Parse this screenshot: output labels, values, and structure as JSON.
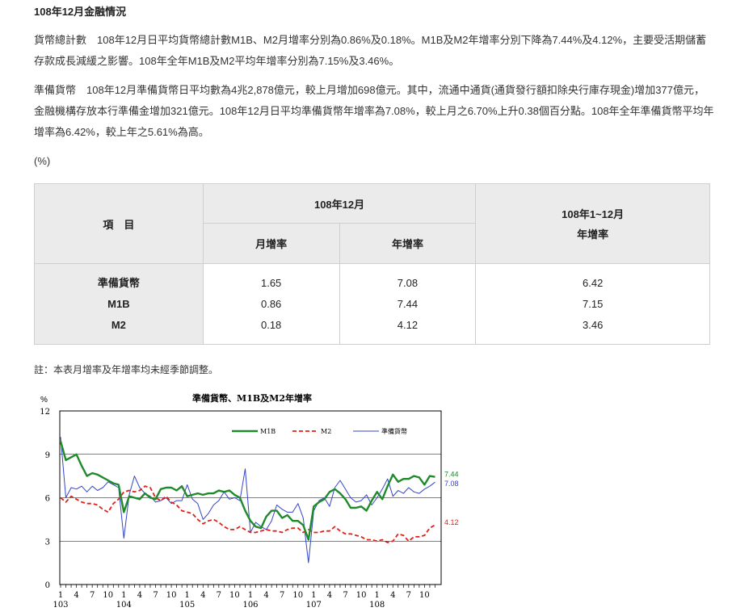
{
  "title": "108年12月金融情況",
  "paragraphs": {
    "p1": "貨幣總計數　108年12月日平均貨幣總計數M1B、M2月增率分別為0.86%及0.18%。M1B及M2年增率分別下降為7.44%及4.12%，主要受活期儲蓄存款成長減緩之影響。108年全年M1B及M2平均年增率分別為7.15%及3.46%。",
    "p2": "準備貨幣　108年12月準備貨幣日平均數為4兆2,878億元，較上月增加698億元。其中，流通中通貨(通貨發行額扣除央行庫存現金)增加377億元，金融機構存放本行準備金增加321億元。108年12月日平均準備貨幣年增率為7.08%，較上月之6.70%上升0.38個百分點。108年全年準備貨幣平均年增率為6.42%，較上年之5.61%為高。"
  },
  "unit": "(%)",
  "table": {
    "item_header": "項　目",
    "month_header": "108年12月",
    "col_mom": "月增率",
    "col_yoy": "年增率",
    "year_header_line1": "108年1~12月",
    "year_header_line2": "年增率",
    "row_names": [
      "準備貨幣",
      "M1B",
      "M2"
    ],
    "mom": [
      "1.65",
      "0.86",
      "0.18"
    ],
    "yoy": [
      "7.08",
      "7.44",
      "4.12"
    ],
    "annual": [
      "6.42",
      "7.15",
      "3.46"
    ]
  },
  "note": "註：本表月增率及年增率均未經季節調整。",
  "chart_data": {
    "type": "line",
    "title": "準備貨幣、M1B及M2年增率",
    "ylabel": "%",
    "ylim": [
      0,
      12
    ],
    "yticks": [
      "0",
      "3",
      "6",
      "9",
      "12"
    ],
    "month_ticks": [
      "1",
      "4",
      "7",
      "10"
    ],
    "years": [
      "103",
      "104",
      "105",
      "106",
      "107",
      "108"
    ],
    "grid": true,
    "legend": "top",
    "colors": {
      "M1B": "#1f8a2a",
      "M2": "#e0201b",
      "reserve": "#3344cc"
    },
    "series": [
      {
        "name": "M1B",
        "key": "M1B",
        "end_label": "7.44",
        "values": [
          9.9,
          8.6,
          8.8,
          9.0,
          8.2,
          7.5,
          7.7,
          7.6,
          7.4,
          7.2,
          7.0,
          6.9,
          5.0,
          6.1,
          6.0,
          5.9,
          6.3,
          6.0,
          5.9,
          6.6,
          6.7,
          6.7,
          6.5,
          6.8,
          6.1,
          6.2,
          6.3,
          6.2,
          6.3,
          6.3,
          6.5,
          6.4,
          6.5,
          6.2,
          6.0,
          5.1,
          4.4,
          4.0,
          3.9,
          4.7,
          5.1,
          5.1,
          4.6,
          4.8,
          4.4,
          4.4,
          4.1,
          3.1,
          5.4,
          5.7,
          5.9,
          6.4,
          6.6,
          6.3,
          5.9,
          5.3,
          5.3,
          5.4,
          5.1,
          5.8,
          6.4,
          5.9,
          6.8,
          7.6,
          7.1,
          7.3,
          7.3,
          7.5,
          7.4,
          6.9,
          7.5,
          7.44
        ]
      },
      {
        "name": "M2",
        "key": "M2",
        "end_label": "4.12",
        "values": [
          6.0,
          5.7,
          6.1,
          5.9,
          5.7,
          5.6,
          5.6,
          5.5,
          5.2,
          5.0,
          5.6,
          5.9,
          6.4,
          6.5,
          6.4,
          6.5,
          6.8,
          6.7,
          6.0,
          5.8,
          6.1,
          5.7,
          5.5,
          5.1,
          5.0,
          4.9,
          4.5,
          4.2,
          4.4,
          4.5,
          4.3,
          4.0,
          3.8,
          3.8,
          4.0,
          3.8,
          3.6,
          3.6,
          3.7,
          3.8,
          3.7,
          3.7,
          3.6,
          3.8,
          3.9,
          3.9,
          3.6,
          3.8,
          3.6,
          3.6,
          3.7,
          3.7,
          4.0,
          3.7,
          3.5,
          3.5,
          3.4,
          3.3,
          3.1,
          3.1,
          3.0,
          3.1,
          2.9,
          3.0,
          3.5,
          3.4,
          3.0,
          3.3,
          3.3,
          3.4,
          3.9,
          4.12
        ]
      },
      {
        "name": "準備貨幣",
        "key": "reserve",
        "end_label": "7.08",
        "values": [
          10.2,
          6.0,
          6.7,
          6.6,
          6.8,
          6.4,
          6.8,
          6.5,
          6.7,
          7.1,
          6.9,
          6.7,
          3.2,
          6.2,
          7.5,
          6.7,
          6.3,
          6.1,
          5.7,
          5.8,
          6.0,
          5.6,
          5.8,
          5.8,
          6.9,
          5.9,
          5.6,
          4.5,
          4.9,
          5.5,
          5.8,
          6.4,
          5.9,
          6.0,
          5.8,
          8.0,
          3.6,
          4.3,
          4.0,
          3.8,
          4.4,
          5.5,
          5.2,
          5.0,
          5.0,
          5.6,
          4.6,
          1.5,
          5.1,
          5.8,
          6.0,
          5.4,
          6.7,
          7.2,
          6.6,
          6.0,
          5.7,
          5.8,
          6.2,
          5.5,
          6.0,
          6.6,
          7.3,
          6.1,
          6.5,
          6.3,
          6.7,
          6.4,
          6.3,
          6.6,
          6.8,
          7.08
        ]
      }
    ]
  }
}
